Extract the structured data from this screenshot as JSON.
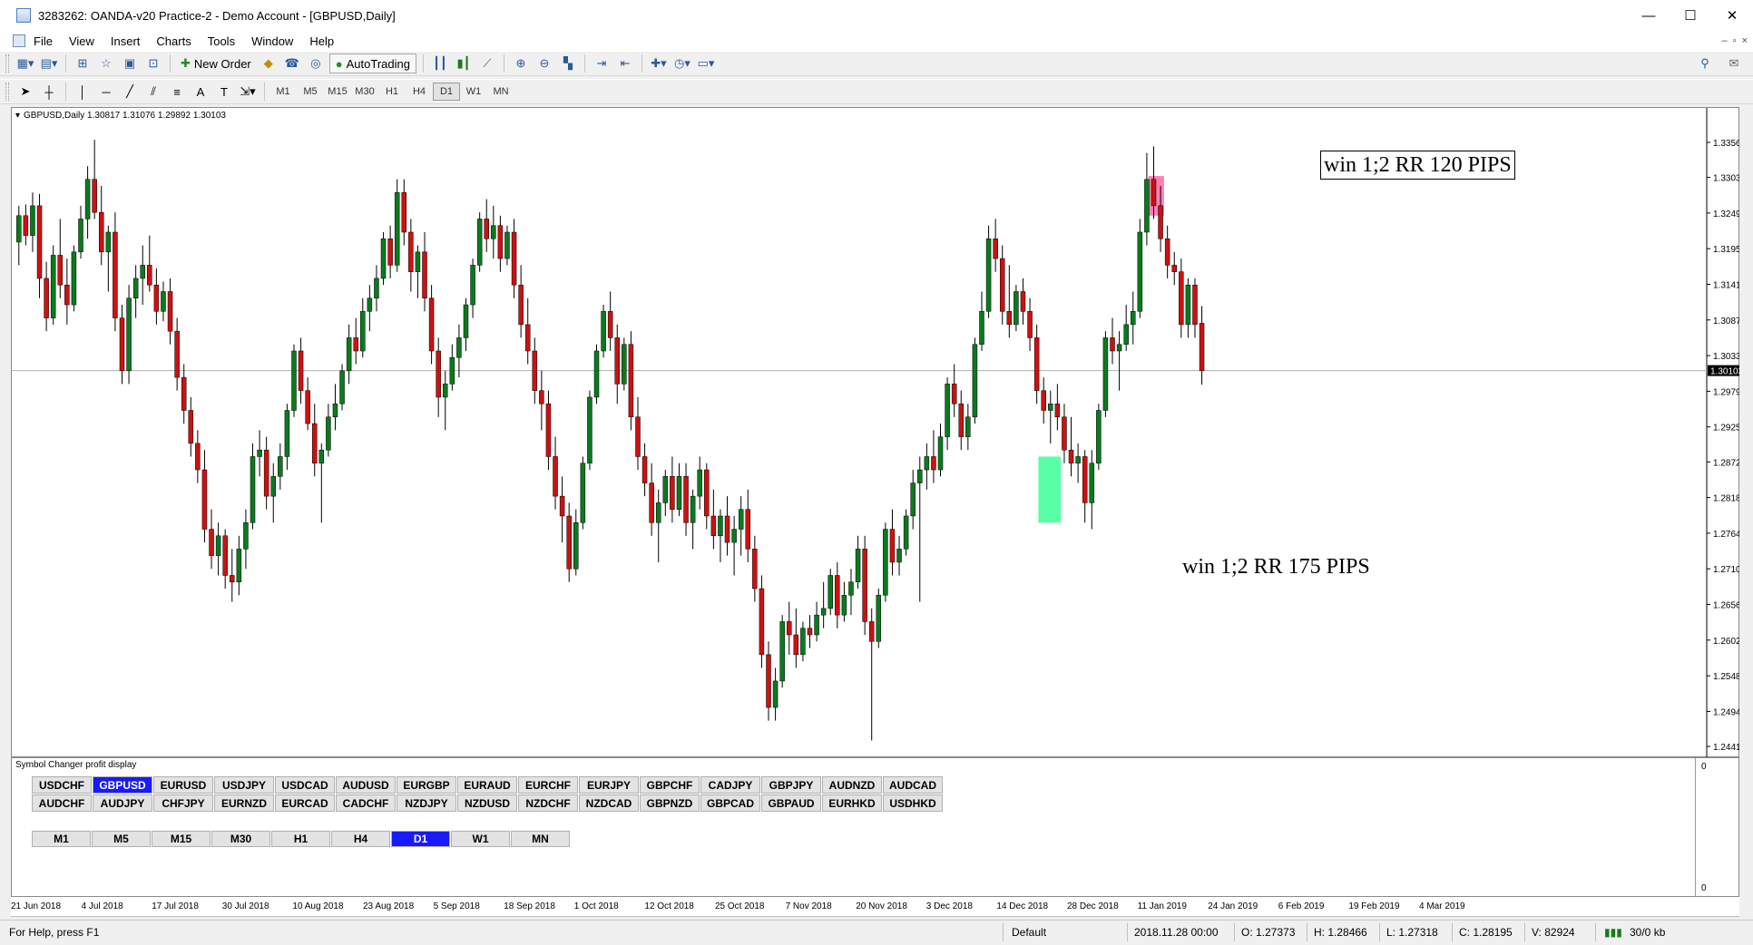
{
  "window": {
    "title": "3283262: OANDA-v20 Practice-2 - Demo Account - [GBPUSD,Daily]",
    "minimize": "—",
    "maximize": "☐",
    "close": "✕"
  },
  "menu": [
    "File",
    "View",
    "Insert",
    "Charts",
    "Tools",
    "Window",
    "Help"
  ],
  "mdi": {
    "minimize": "–",
    "restore": "▫",
    "close": "×"
  },
  "toolbar": {
    "new_order": "New Order",
    "autotrading": "AutoTrading"
  },
  "timeframes": [
    "M1",
    "M5",
    "M15",
    "M30",
    "H1",
    "H4",
    "D1",
    "W1",
    "MN"
  ],
  "active_timeframe": "D1",
  "chart": {
    "header": "GBPUSD,Daily  1.30817 1.31076 1.29892 1.30103",
    "current_price": "1.30103",
    "price_labels": [
      "1.33560",
      "1.33030",
      "1.32490",
      "1.31950",
      "1.31410",
      "1.30870",
      "1.30330",
      "1.29790",
      "1.29250",
      "1.28720",
      "1.28180",
      "1.27640",
      "1.27100",
      "1.26560",
      "1.26020",
      "1.25480",
      "1.24940",
      "1.24410"
    ],
    "annotation_1": "win 1;2 RR  120 PIPS",
    "annotation_2": "win 1;2 RR  175 PIPS",
    "colors": {
      "bull": "#0a7a1f",
      "bear": "#cc1111",
      "wick": "#000000",
      "highlight_red": "#ff5fa0",
      "highlight_green": "#30ff90"
    }
  },
  "chart_data": {
    "type": "candlestick",
    "symbol": "GBPUSD",
    "timeframe": "Daily",
    "ylim": [
      1.2441,
      1.3356
    ],
    "ohlc": [
      [
        1.3205,
        1.326,
        1.317,
        1.3245
      ],
      [
        1.3245,
        1.3262,
        1.32,
        1.3215
      ],
      [
        1.3215,
        1.328,
        1.319,
        1.326
      ],
      [
        1.326,
        1.3278,
        1.312,
        1.315
      ],
      [
        1.315,
        1.3175,
        1.307,
        1.309
      ],
      [
        1.309,
        1.32,
        1.308,
        1.3185
      ],
      [
        1.3185,
        1.324,
        1.312,
        1.314
      ],
      [
        1.314,
        1.318,
        1.308,
        1.311
      ],
      [
        1.311,
        1.32,
        1.31,
        1.319
      ],
      [
        1.319,
        1.326,
        1.318,
        1.324
      ],
      [
        1.324,
        1.332,
        1.321,
        1.33
      ],
      [
        1.33,
        1.336,
        1.324,
        1.325
      ],
      [
        1.325,
        1.329,
        1.317,
        1.319
      ],
      [
        1.319,
        1.323,
        1.313,
        1.322
      ],
      [
        1.322,
        1.325,
        1.307,
        1.309
      ],
      [
        1.309,
        1.311,
        1.299,
        1.301
      ],
      [
        1.301,
        1.314,
        1.299,
        1.312
      ],
      [
        1.312,
        1.317,
        1.309,
        1.315
      ],
      [
        1.315,
        1.32,
        1.311,
        1.317
      ],
      [
        1.317,
        1.3215,
        1.313,
        1.314
      ],
      [
        1.314,
        1.3165,
        1.308,
        1.31
      ],
      [
        1.31,
        1.3145,
        1.3085,
        1.313
      ],
      [
        1.313,
        1.315,
        1.305,
        1.307
      ],
      [
        1.307,
        1.309,
        1.298,
        1.3
      ],
      [
        1.3,
        1.302,
        1.293,
        1.295
      ],
      [
        1.295,
        1.297,
        1.288,
        1.29
      ],
      [
        1.29,
        1.292,
        1.284,
        1.286
      ],
      [
        1.286,
        1.289,
        1.275,
        1.277
      ],
      [
        1.277,
        1.28,
        1.271,
        1.273
      ],
      [
        1.273,
        1.278,
        1.27,
        1.276
      ],
      [
        1.276,
        1.277,
        1.268,
        1.27
      ],
      [
        1.27,
        1.274,
        1.266,
        1.269
      ],
      [
        1.269,
        1.276,
        1.267,
        1.274
      ],
      [
        1.274,
        1.28,
        1.271,
        1.278
      ],
      [
        1.278,
        1.29,
        1.277,
        1.288
      ],
      [
        1.288,
        1.292,
        1.285,
        1.289
      ],
      [
        1.289,
        1.291,
        1.28,
        1.282
      ],
      [
        1.282,
        1.287,
        1.278,
        1.285
      ],
      [
        1.285,
        1.29,
        1.283,
        1.288
      ],
      [
        1.288,
        1.296,
        1.286,
        1.295
      ],
      [
        1.295,
        1.305,
        1.294,
        1.304
      ],
      [
        1.304,
        1.306,
        1.296,
        1.298
      ],
      [
        1.298,
        1.3,
        1.292,
        1.293
      ],
      [
        1.293,
        1.296,
        1.285,
        1.287
      ],
      [
        1.287,
        1.29,
        1.278,
        1.289
      ],
      [
        1.289,
        1.296,
        1.288,
        1.294
      ],
      [
        1.294,
        1.299,
        1.292,
        1.296
      ],
      [
        1.296,
        1.302,
        1.295,
        1.301
      ],
      [
        1.301,
        1.308,
        1.299,
        1.306
      ],
      [
        1.306,
        1.309,
        1.302,
        1.304
      ],
      [
        1.304,
        1.312,
        1.303,
        1.31
      ],
      [
        1.31,
        1.314,
        1.307,
        1.312
      ],
      [
        1.312,
        1.317,
        1.31,
        1.315
      ],
      [
        1.315,
        1.322,
        1.314,
        1.321
      ],
      [
        1.321,
        1.323,
        1.315,
        1.317
      ],
      [
        1.317,
        1.33,
        1.316,
        1.328
      ],
      [
        1.328,
        1.33,
        1.32,
        1.322
      ],
      [
        1.322,
        1.324,
        1.313,
        1.316
      ],
      [
        1.316,
        1.32,
        1.312,
        1.319
      ],
      [
        1.319,
        1.322,
        1.31,
        1.312
      ],
      [
        1.312,
        1.314,
        1.302,
        1.304
      ],
      [
        1.304,
        1.306,
        1.294,
        1.297
      ],
      [
        1.297,
        1.301,
        1.292,
        1.299
      ],
      [
        1.299,
        1.305,
        1.298,
        1.303
      ],
      [
        1.303,
        1.308,
        1.3,
        1.306
      ],
      [
        1.306,
        1.312,
        1.304,
        1.311
      ],
      [
        1.311,
        1.318,
        1.309,
        1.317
      ],
      [
        1.317,
        1.325,
        1.316,
        1.324
      ],
      [
        1.324,
        1.327,
        1.319,
        1.321
      ],
      [
        1.321,
        1.326,
        1.318,
        1.323
      ],
      [
        1.323,
        1.3245,
        1.316,
        1.318
      ],
      [
        1.318,
        1.323,
        1.317,
        1.322
      ],
      [
        1.322,
        1.324,
        1.312,
        1.314
      ],
      [
        1.314,
        1.317,
        1.306,
        1.308
      ],
      [
        1.308,
        1.312,
        1.302,
        1.304
      ],
      [
        1.304,
        1.306,
        1.296,
        1.298
      ],
      [
        1.298,
        1.301,
        1.292,
        1.296
      ],
      [
        1.296,
        1.298,
        1.286,
        1.288
      ],
      [
        1.288,
        1.291,
        1.28,
        1.282
      ],
      [
        1.282,
        1.285,
        1.275,
        1.279
      ],
      [
        1.279,
        1.281,
        1.269,
        1.271
      ],
      [
        1.271,
        1.28,
        1.27,
        1.278
      ],
      [
        1.278,
        1.288,
        1.277,
        1.287
      ],
      [
        1.287,
        1.298,
        1.286,
        1.297
      ],
      [
        1.297,
        1.305,
        1.296,
        1.304
      ],
      [
        1.304,
        1.311,
        1.303,
        1.31
      ],
      [
        1.31,
        1.313,
        1.304,
        1.306
      ],
      [
        1.306,
        1.308,
        1.296,
        1.299
      ],
      [
        1.299,
        1.306,
        1.298,
        1.305
      ],
      [
        1.305,
        1.307,
        1.292,
        1.294
      ],
      [
        1.294,
        1.297,
        1.286,
        1.288
      ],
      [
        1.288,
        1.29,
        1.282,
        1.284
      ],
      [
        1.284,
        1.287,
        1.276,
        1.278
      ],
      [
        1.278,
        1.283,
        1.272,
        1.281
      ],
      [
        1.281,
        1.286,
        1.279,
        1.285
      ],
      [
        1.285,
        1.288,
        1.278,
        1.28
      ],
      [
        1.28,
        1.287,
        1.279,
        1.285
      ],
      [
        1.285,
        1.287,
        1.276,
        1.278
      ],
      [
        1.278,
        1.283,
        1.274,
        1.282
      ],
      [
        1.282,
        1.288,
        1.28,
        1.286
      ],
      [
        1.286,
        1.287,
        1.277,
        1.279
      ],
      [
        1.279,
        1.283,
        1.274,
        1.276
      ],
      [
        1.276,
        1.28,
        1.272,
        1.279
      ],
      [
        1.279,
        1.282,
        1.273,
        1.275
      ],
      [
        1.275,
        1.279,
        1.27,
        1.277
      ],
      [
        1.277,
        1.282,
        1.273,
        1.28
      ],
      [
        1.28,
        1.283,
        1.272,
        1.274
      ],
      [
        1.274,
        1.276,
        1.266,
        1.268
      ],
      [
        1.268,
        1.27,
        1.256,
        1.258
      ],
      [
        1.258,
        1.26,
        1.248,
        1.25
      ],
      [
        1.25,
        1.256,
        1.248,
        1.254
      ],
      [
        1.254,
        1.264,
        1.253,
        1.263
      ],
      [
        1.263,
        1.266,
        1.258,
        1.261
      ],
      [
        1.261,
        1.265,
        1.256,
        1.258
      ],
      [
        1.258,
        1.263,
        1.257,
        1.262
      ],
      [
        1.262,
        1.264,
        1.259,
        1.261
      ],
      [
        1.261,
        1.266,
        1.26,
        1.264
      ],
      [
        1.264,
        1.269,
        1.262,
        1.265
      ],
      [
        1.265,
        1.271,
        1.264,
        1.27
      ],
      [
        1.27,
        1.272,
        1.262,
        1.264
      ],
      [
        1.264,
        1.269,
        1.263,
        1.267
      ],
      [
        1.267,
        1.271,
        1.264,
        1.269
      ],
      [
        1.269,
        1.276,
        1.268,
        1.274
      ],
      [
        1.274,
        1.276,
        1.261,
        1.263
      ],
      [
        1.263,
        1.265,
        1.245,
        1.26
      ],
      [
        1.26,
        1.268,
        1.259,
        1.267
      ],
      [
        1.267,
        1.278,
        1.266,
        1.277
      ],
      [
        1.277,
        1.28,
        1.27,
        1.272
      ],
      [
        1.272,
        1.276,
        1.27,
        1.274
      ],
      [
        1.274,
        1.28,
        1.273,
        1.279
      ],
      [
        1.279,
        1.286,
        1.277,
        1.284
      ],
      [
        1.284,
        1.288,
        1.266,
        1.286
      ],
      [
        1.286,
        1.29,
        1.283,
        1.288
      ],
      [
        1.288,
        1.292,
        1.284,
        1.286
      ],
      [
        1.286,
        1.293,
        1.285,
        1.291
      ],
      [
        1.291,
        1.3,
        1.289,
        1.299
      ],
      [
        1.299,
        1.302,
        1.294,
        1.296
      ],
      [
        1.296,
        1.298,
        1.289,
        1.291
      ],
      [
        1.291,
        1.296,
        1.289,
        1.294
      ],
      [
        1.294,
        1.306,
        1.293,
        1.305
      ],
      [
        1.305,
        1.313,
        1.304,
        1.31
      ],
      [
        1.31,
        1.323,
        1.309,
        1.321
      ],
      [
        1.321,
        1.324,
        1.316,
        1.318
      ],
      [
        1.318,
        1.32,
        1.308,
        1.31
      ],
      [
        1.31,
        1.317,
        1.306,
        1.308
      ],
      [
        1.308,
        1.314,
        1.307,
        1.313
      ],
      [
        1.313,
        1.315,
        1.308,
        1.31
      ],
      [
        1.31,
        1.312,
        1.304,
        1.306
      ],
      [
        1.306,
        1.308,
        1.296,
        1.298
      ],
      [
        1.298,
        1.3,
        1.293,
        1.295
      ],
      [
        1.295,
        1.298,
        1.29,
        1.296
      ],
      [
        1.296,
        1.299,
        1.292,
        1.294
      ],
      [
        1.294,
        1.296,
        1.287,
        1.289
      ],
      [
        1.289,
        1.294,
        1.285,
        1.287
      ],
      [
        1.287,
        1.29,
        1.284,
        1.288
      ],
      [
        1.288,
        1.289,
        1.278,
        1.281
      ],
      [
        1.281,
        1.289,
        1.277,
        1.287
      ],
      [
        1.287,
        1.296,
        1.286,
        1.295
      ],
      [
        1.295,
        1.307,
        1.294,
        1.306
      ],
      [
        1.306,
        1.309,
        1.302,
        1.304
      ],
      [
        1.304,
        1.307,
        1.298,
        1.305
      ],
      [
        1.305,
        1.311,
        1.304,
        1.308
      ],
      [
        1.308,
        1.313,
        1.305,
        1.31
      ],
      [
        1.31,
        1.324,
        1.309,
        1.322
      ],
      [
        1.322,
        1.334,
        1.32,
        1.33
      ],
      [
        1.33,
        1.335,
        1.324,
        1.326
      ],
      [
        1.326,
        1.329,
        1.319,
        1.321
      ],
      [
        1.321,
        1.323,
        1.315,
        1.317
      ],
      [
        1.317,
        1.319,
        1.314,
        1.316
      ],
      [
        1.316,
        1.318,
        1.306,
        1.308
      ],
      [
        1.308,
        1.315,
        1.306,
        1.314
      ],
      [
        1.314,
        1.315,
        1.306,
        1.308
      ],
      [
        1.3082,
        1.3108,
        1.2989,
        1.301
      ]
    ]
  },
  "panel": {
    "title": "Symbol Changer profit display",
    "symbols_row1": [
      "USDCHF",
      "GBPUSD",
      "EURUSD",
      "USDJPY",
      "USDCAD",
      "AUDUSD",
      "EURGBP",
      "EURAUD",
      "EURCHF",
      "EURJPY",
      "GBPCHF",
      "CADJPY",
      "GBPJPY",
      "AUDNZD",
      "AUDCAD"
    ],
    "symbols_row2": [
      "AUDCHF",
      "AUDJPY",
      "CHFJPY",
      "EURNZD",
      "EURCAD",
      "CADCHF",
      "NZDJPY",
      "NZDUSD",
      "NZDCHF",
      "NZDCAD",
      "GBPNZD",
      "GBPCAD",
      "GBPAUD",
      "EURHKD",
      "USDHKD"
    ],
    "active_symbol": "GBPUSD",
    "scale_top": "0",
    "scale_bottom": "0"
  },
  "xaxis_labels": [
    "21 Jun 2018",
    "4 Jul 2018",
    "17 Jul 2018",
    "30 Jul 2018",
    "10 Aug 2018",
    "23 Aug 2018",
    "5 Sep 2018",
    "18 Sep 2018",
    "1 Oct 2018",
    "12 Oct 2018",
    "25 Oct 2018",
    "7 Nov 2018",
    "20 Nov 2018",
    "3 Dec 2018",
    "14 Dec 2018",
    "28 Dec 2018",
    "11 Jan 2019",
    "24 Jan 2019",
    "6 Feb 2019",
    "19 Feb 2019",
    "4 Mar 2019"
  ],
  "status": {
    "help": "For Help, press F1",
    "profile": "Default",
    "datetime": "2018.11.28 00:00",
    "open": "O: 1.27373",
    "high": "H: 1.28466",
    "low": "L: 1.27318",
    "close": "C: 1.28195",
    "volume": "V: 82924",
    "traffic": "30/0 kb"
  }
}
